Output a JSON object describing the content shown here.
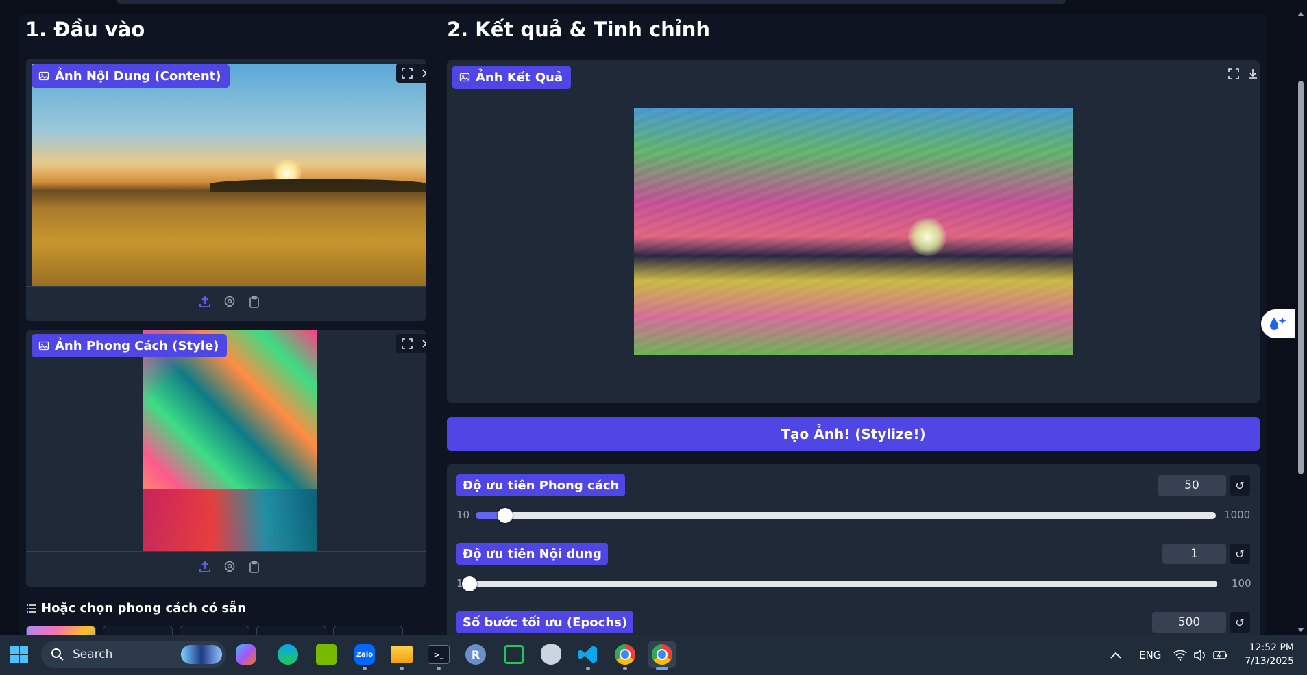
{
  "left_column": {
    "title": "1. Đầu vào",
    "content_panel": {
      "label": "Ảnh Nội Dung (Content)"
    },
    "style_panel": {
      "label": "Ảnh Phong Cách (Style)"
    },
    "presets": {
      "title": "Hoặc chọn phong cách có sẵn"
    }
  },
  "right_column": {
    "title": "2. Kết quả & Tinh chỉnh",
    "result_panel": {
      "label": "Ảnh Kết Quả"
    },
    "stylize_button": "Tạo Ảnh! (Stylize!)",
    "sliders": [
      {
        "label": "Độ ưu tiên Phong cách",
        "value": "50",
        "min": "10",
        "max": "1000",
        "fraction": 0.04
      },
      {
        "label": "Độ ưu tiên Nội dung",
        "value": "1",
        "min": "1",
        "max": "100",
        "fraction": 0.0
      },
      {
        "label": "Số bước tối ưu (Epochs)",
        "value": "500"
      }
    ]
  },
  "taskbar": {
    "search_placeholder": "Search",
    "language": "ENG",
    "time": "12:52 PM",
    "date": "7/13/2025",
    "apps": [
      "windows-start",
      "copilot",
      "edge",
      "nvidia",
      "zalo",
      "file-explorer",
      "terminal",
      "r",
      "snipping-tool",
      "postgresql",
      "vscode",
      "chrome",
      "chrome-profile"
    ]
  },
  "colors": {
    "accent": "#4f46e5",
    "panel": "#1f2937",
    "background": "#0b0f19"
  }
}
